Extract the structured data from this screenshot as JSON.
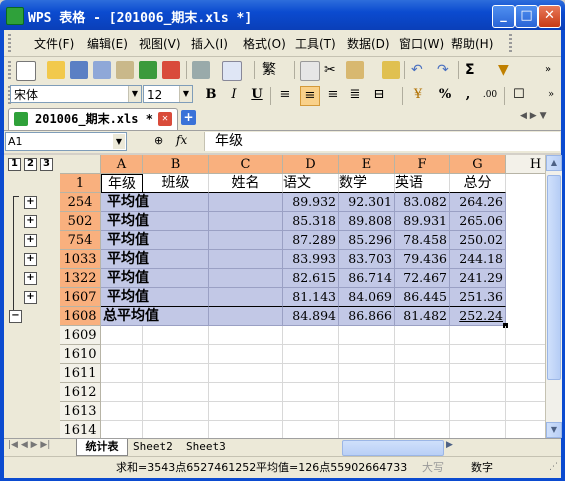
{
  "window": {
    "title": "WPS 表格 - [201006_期末.xls *]"
  },
  "menu": [
    "文件(F)",
    "编辑(E)",
    "视图(V)",
    "插入(I)",
    "格式(O)",
    "工具(T)",
    "数据(D)",
    "窗口(W)",
    "帮助(H)"
  ],
  "toolbar": {
    "fan_label": "繁",
    "sigma_label": "Σ"
  },
  "format": {
    "font_name": "宋体",
    "font_size": "12",
    "bold": "B",
    "italic": "I",
    "underline": "U",
    "percent": "%",
    "comma": ","
  },
  "doc_tab": {
    "label": "201006_期末.xls *"
  },
  "formula": {
    "name_box": "A1",
    "fx": "fx",
    "content": "年级"
  },
  "outline_levels": [
    "1",
    "2",
    "3"
  ],
  "columns": [
    "A",
    "B",
    "C",
    "D",
    "E",
    "F",
    "G",
    "H"
  ],
  "header_row": {
    "row": "1",
    "cells": [
      "年级",
      "班级",
      "姓名",
      "语文",
      "数学",
      "英语",
      "总分"
    ]
  },
  "rows": [
    {
      "row": "254",
      "label": "平均值",
      "yuwen": "89.932",
      "shuxue": "92.301",
      "yingyu": "83.082",
      "zongfen": "264.26"
    },
    {
      "row": "502",
      "label": "平均值",
      "yuwen": "85.318",
      "shuxue": "89.808",
      "yingyu": "89.931",
      "zongfen": "265.06"
    },
    {
      "row": "754",
      "label": "平均值",
      "yuwen": "87.289",
      "shuxue": "85.296",
      "yingyu": "78.458",
      "zongfen": "250.02"
    },
    {
      "row": "1033",
      "label": "平均值",
      "yuwen": "83.993",
      "shuxue": "83.703",
      "yingyu": "79.436",
      "zongfen": "244.18"
    },
    {
      "row": "1322",
      "label": "平均值",
      "yuwen": "82.615",
      "shuxue": "86.714",
      "yingyu": "72.467",
      "zongfen": "241.29"
    },
    {
      "row": "1607",
      "label": "平均值",
      "yuwen": "81.143",
      "shuxue": "84.069",
      "yingyu": "86.445",
      "zongfen": "251.36"
    }
  ],
  "total_row": {
    "row": "1608",
    "label": "总平均值",
    "yuwen": "84.894",
    "shuxue": "86.866",
    "yingyu": "81.482",
    "zongfen": "252.24"
  },
  "empty_rows": [
    "1609",
    "1610",
    "1611",
    "1612",
    "1613",
    "1614"
  ],
  "sheets": [
    "统计表",
    "Sheet2",
    "Sheet3"
  ],
  "status": {
    "sum": "求和=3543点6527461252",
    "avg": "平均值=126点55902664733",
    "caps": "大写",
    "num": "数字"
  },
  "colors": {
    "title_blue": "#0b4bd0",
    "selected_header": "#f9b07e",
    "selection": "#c2c8e6"
  }
}
